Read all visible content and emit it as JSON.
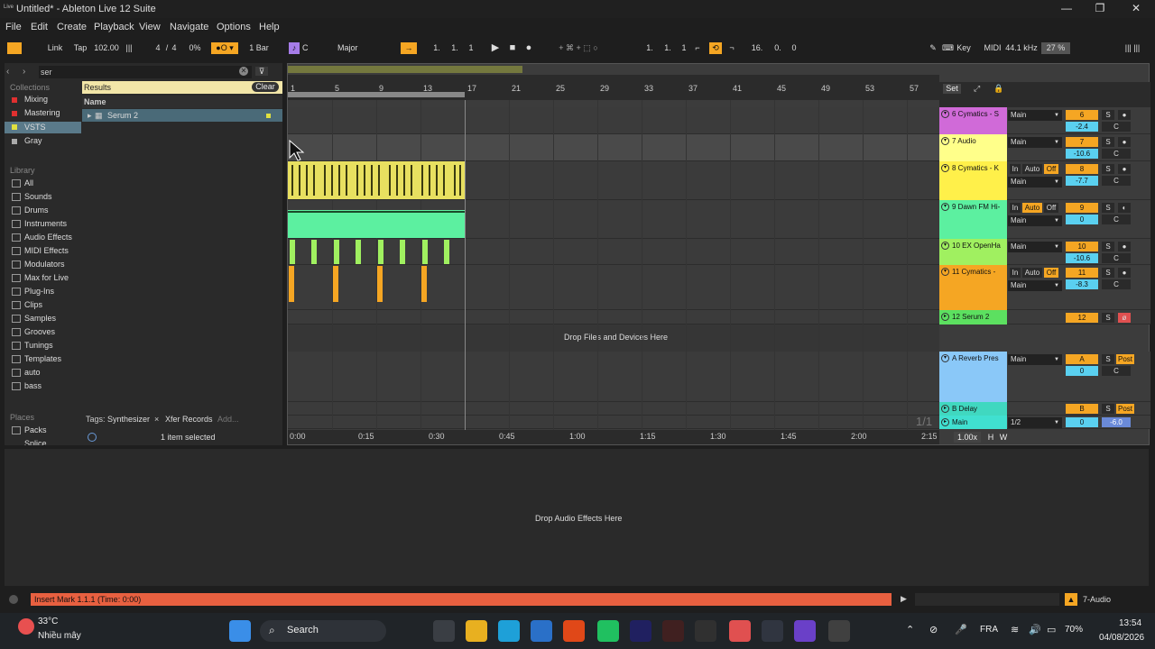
{
  "window": {
    "title": "Untitled* - Ableton Live 12 Suite",
    "logo": "Live"
  },
  "menu": [
    "File",
    "Edit",
    "Create",
    "Playback",
    "View",
    "Navigate",
    "Options",
    "Help"
  ],
  "transport": {
    "link": "Link",
    "tap": "Tap",
    "tempo": "102.00",
    "sig_num": "4",
    "sig_den": "4",
    "cpu": "0%",
    "quant": "1 Bar",
    "key": "C",
    "scale": "Major",
    "position": [
      "1.",
      "1.",
      "1"
    ],
    "loop_start": [
      "1.",
      "1.",
      "1"
    ],
    "loop_len": [
      "16.",
      "0.",
      "0"
    ],
    "key_label": "Key",
    "midi_label": "MIDI",
    "sample_rate": "44.1 kHz",
    "zoom": "27 %"
  },
  "browser": {
    "search_value": "ser",
    "results_label": "Results",
    "clear_label": "Clear",
    "name_header": "Name",
    "result_item": "Serum 2",
    "collections_header": "Collections",
    "collections": [
      {
        "label": "Mixing",
        "color": "#e03030"
      },
      {
        "label": "Mastering",
        "color": "#e03030"
      },
      {
        "label": "VSTS",
        "color": "#e0e040"
      },
      {
        "label": "Gray",
        "color": "#aaaaaa"
      }
    ],
    "library_header": "Library",
    "library": [
      "All",
      "Sounds",
      "Drums",
      "Instruments",
      "Audio Effects",
      "MIDI Effects",
      "Modulators",
      "Max for Live",
      "Plug-Ins",
      "Clips",
      "Samples",
      "Grooves",
      "Tunings",
      "Templates",
      "auto",
      "bass"
    ],
    "places_header": "Places",
    "places": [
      "Packs",
      "Splice"
    ],
    "tags_label": "Tags:",
    "tags": [
      "Synthesizer",
      "Xfer Records"
    ],
    "add_label": "Add...",
    "selection_status": "1 item selected"
  },
  "arrangement": {
    "bars": [
      "1",
      "5",
      "9",
      "13",
      "17",
      "21",
      "25",
      "29",
      "33",
      "37",
      "41",
      "45",
      "49",
      "53",
      "57"
    ],
    "times": [
      "0:00",
      "0:15",
      "0:30",
      "0:45",
      "1:00",
      "1:15",
      "1:30",
      "1:45",
      "2:00",
      "2:15"
    ],
    "drop_text": "Drop Files and Devices Here",
    "set_label": "Set",
    "page_indicator": "1/1",
    "zoom_level": "1.00x",
    "h_label": "H",
    "w_label": "W"
  },
  "tracks": [
    {
      "name": "6 Cymatics - S",
      "color": "#d06ad8",
      "io": "Main",
      "num": "6",
      "vol": "-2.4",
      "pan": "C"
    },
    {
      "name": "7 Audio",
      "color": "#ffff8a",
      "io": "Main",
      "num": "7",
      "vol": "-10.6",
      "pan": "C"
    },
    {
      "name": "8 Cymatics - K",
      "color": "#fff04a",
      "io": "Main",
      "num": "8",
      "vol": "-7.7",
      "pan": "C"
    },
    {
      "name": "9 Dawn FM Hi-",
      "color": "#5cf0a0",
      "io": "Main",
      "num": "9",
      "vol": "0",
      "pan": "C"
    },
    {
      "name": "10 EX  OpenHa",
      "color": "#a0f060",
      "io": "Main",
      "num": "10",
      "vol": "-10.6",
      "pan": "C"
    },
    {
      "name": "11 Cymatics -",
      "color": "#f5a623",
      "io": "Main",
      "num": "11",
      "vol": "-8.3",
      "pan": "C"
    },
    {
      "name": "12 Serum 2",
      "color": "#5ce060",
      "io": "",
      "num": "12",
      "vol": "",
      "pan": ""
    },
    {
      "name": "A Reverb Pres",
      "color": "#8ac8f8",
      "io": "Main",
      "num": "A",
      "vol": "0",
      "pan": "C"
    },
    {
      "name": "B Delay",
      "color": "#40d8c0",
      "io": "",
      "num": "B",
      "vol": "",
      "pan": ""
    },
    {
      "name": "Main",
      "color": "#40e0d0",
      "io": "1/2",
      "num": "0",
      "vol": "-6.0",
      "pan": ""
    }
  ],
  "track_labels": {
    "in": "In",
    "auto": "Auto",
    "off": "Off",
    "s": "S",
    "post": "Post",
    "minus_inf": "-∞"
  },
  "device_area": {
    "drop_text": "Drop Audio Effects Here"
  },
  "status": {
    "message": "Insert Mark 1.1.1 (Time: 0:00)",
    "track": "7-Audio"
  },
  "taskbar": {
    "temperature": "33°C",
    "weather": "Nhiều mây",
    "search": "Search",
    "language": "FRA",
    "battery": "70%",
    "time": "13:54",
    "date": "04/08/2026"
  }
}
